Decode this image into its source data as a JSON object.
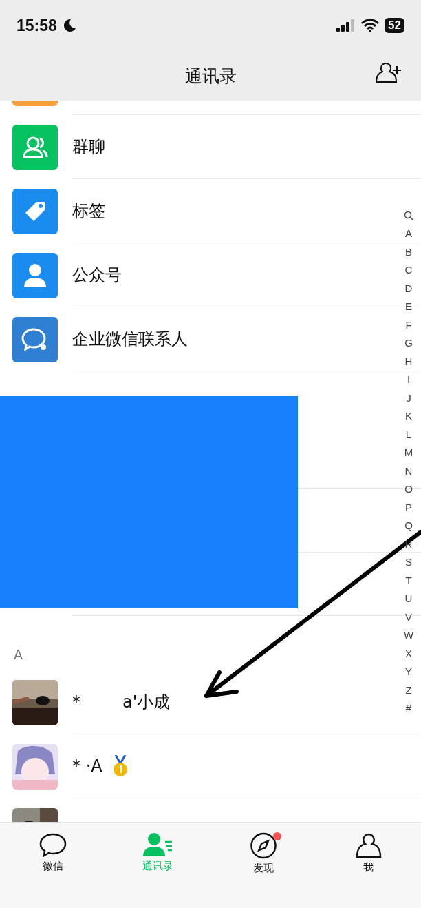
{
  "status_bar": {
    "time": "15:58",
    "battery": "52"
  },
  "nav": {
    "title": "通讯录"
  },
  "functions": [
    {
      "kind": "friends",
      "color": "#fa9d3b"
    },
    {
      "kind": "group",
      "label": "群聊",
      "color": "#08c160"
    },
    {
      "kind": "tag",
      "label": "标签",
      "color": "#1a8cf0"
    },
    {
      "kind": "official",
      "label": "公众号",
      "color": "#1a8cf0"
    },
    {
      "kind": "wecom",
      "label": "企业微信联系人",
      "color": "#2f7fd2"
    }
  ],
  "sections": [
    {
      "header": "A",
      "contacts": [
        {
          "name": "*        a'小成",
          "kind": "picture"
        },
        {
          "name": "* ·A",
          "kind": "picture",
          "medal": true
        },
        {
          "kind": "picture"
        }
      ]
    }
  ],
  "index": [
    "A",
    "B",
    "C",
    "D",
    "E",
    "F",
    "G",
    "H",
    "I",
    "J",
    "K",
    "L",
    "M",
    "N",
    "O",
    "P",
    "Q",
    "R",
    "S",
    "T",
    "U",
    "V",
    "W",
    "X",
    "Y",
    "Z",
    "#"
  ],
  "tabs": [
    {
      "kind": "chat",
      "label": "微信",
      "selected": false,
      "badge": false
    },
    {
      "kind": "contacts",
      "label": "通讯录",
      "selected": true,
      "badge": false
    },
    {
      "kind": "discover",
      "label": "发现",
      "selected": false,
      "badge": true
    },
    {
      "kind": "me",
      "label": "我",
      "selected": false,
      "badge": false
    }
  ]
}
